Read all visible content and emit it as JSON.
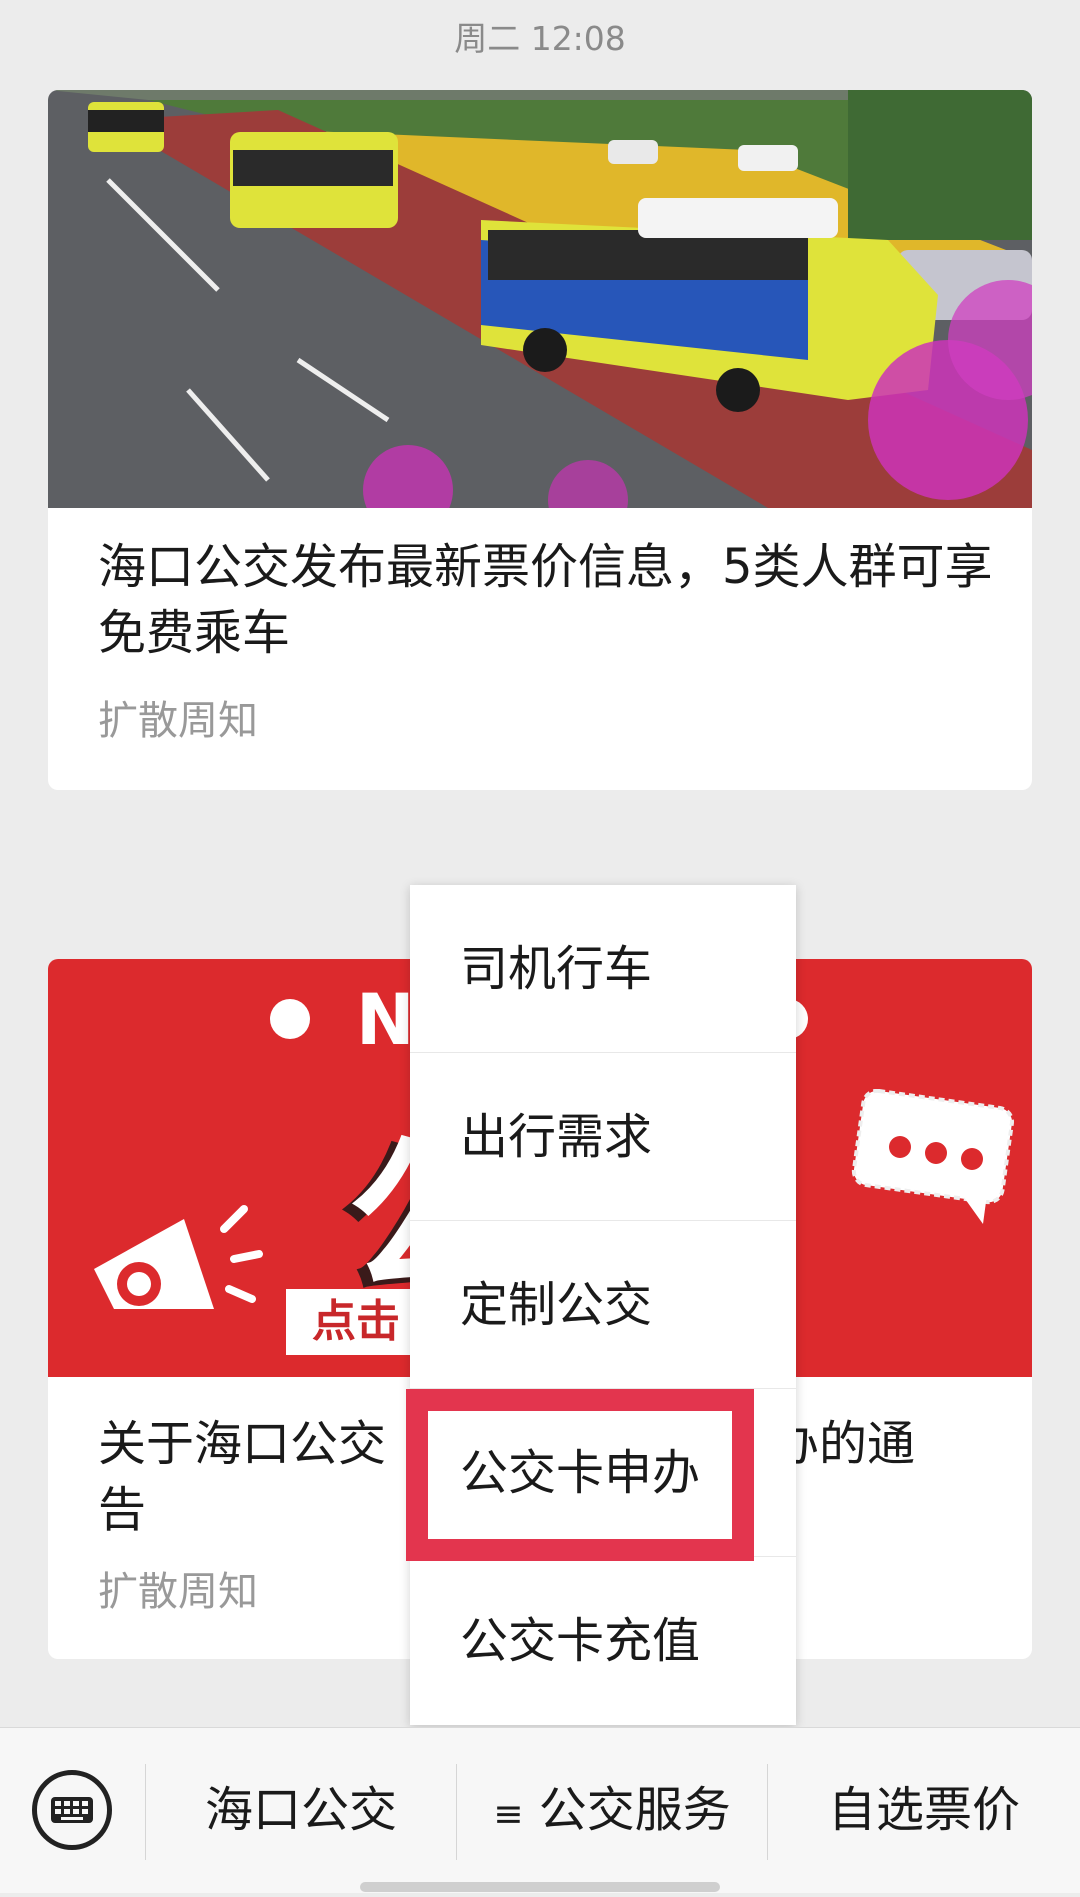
{
  "status_bar": {
    "time": "周二 12:08"
  },
  "articles": [
    {
      "title": "海口公交发布最新票价信息，5类人群可享免费乘车",
      "meta": "扩散周知"
    },
    {
      "title_left": "关于海口公交",
      "title_right": "申办的通",
      "title_line2": "告",
      "meta": "扩散周知",
      "banner": {
        "letter": "N",
        "glyph": "公",
        "button_text": "点击",
        "color": "#dc2a2d"
      }
    }
  ],
  "menu": {
    "items": [
      {
        "label": "司机行车"
      },
      {
        "label": "出行需求"
      },
      {
        "label": "定制公交"
      },
      {
        "label": "公交卡申办",
        "highlighted": true
      },
      {
        "label": "公交卡充值"
      }
    ],
    "highlight_color": "#e3354e"
  },
  "bottom_bar": {
    "keyboard_icon": "keyboard-icon",
    "items": [
      {
        "label": "海口公交"
      },
      {
        "prefix": "≡",
        "label": "公交服务"
      },
      {
        "label": "自选票价"
      }
    ]
  }
}
